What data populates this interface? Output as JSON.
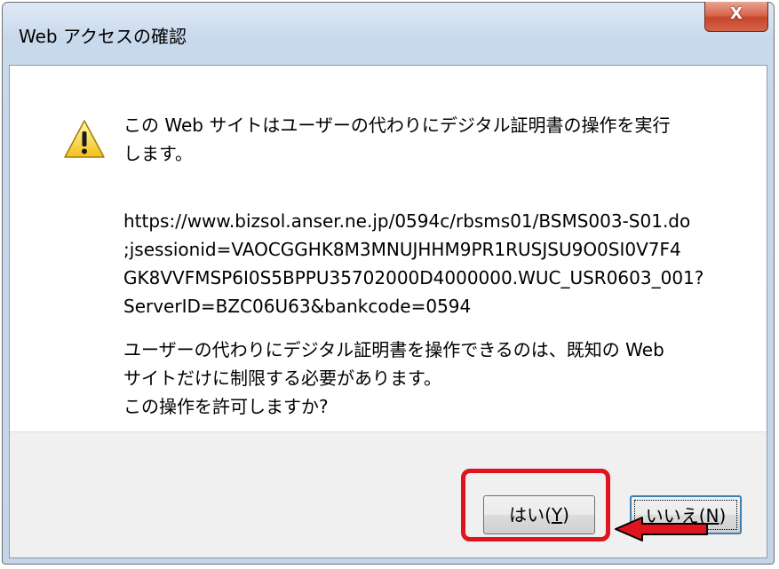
{
  "window": {
    "title": "Web アクセスの確認",
    "close_label": "X"
  },
  "message": {
    "main": "この Web サイトはユーザーの代わりにデジタル証明書の操作を実行\nします。",
    "url": "https://www.bizsol.anser.ne.jp/0594c/rbsms01/BSMS003-S01.do\n;jsessionid=VAOCGGHK8M3MNUJHHM9PR1RUSJSU9O0SI0V7F4\nGK8VVFMSP6I0S5BPPU35702000D4000000.WUC_USR0603_001?\nServerID=BZC06U63&bankcode=0594",
    "question": "ユーザーの代わりにデジタル証明書を操作できるのは、既知の Web\nサイトだけに制限する必要があります。\nこの操作を許可しますか?"
  },
  "buttons": {
    "yes_prefix": "はい(",
    "yes_key": "Y",
    "yes_suffix": ")",
    "no_prefix": "いいえ(",
    "no_key": "N",
    "no_suffix": ")"
  },
  "icons": {
    "warning": "warning-icon",
    "pointer_arrow": "arrow-icon"
  },
  "colors": {
    "highlight": "#e0141e",
    "arrow": "#e0141e"
  }
}
